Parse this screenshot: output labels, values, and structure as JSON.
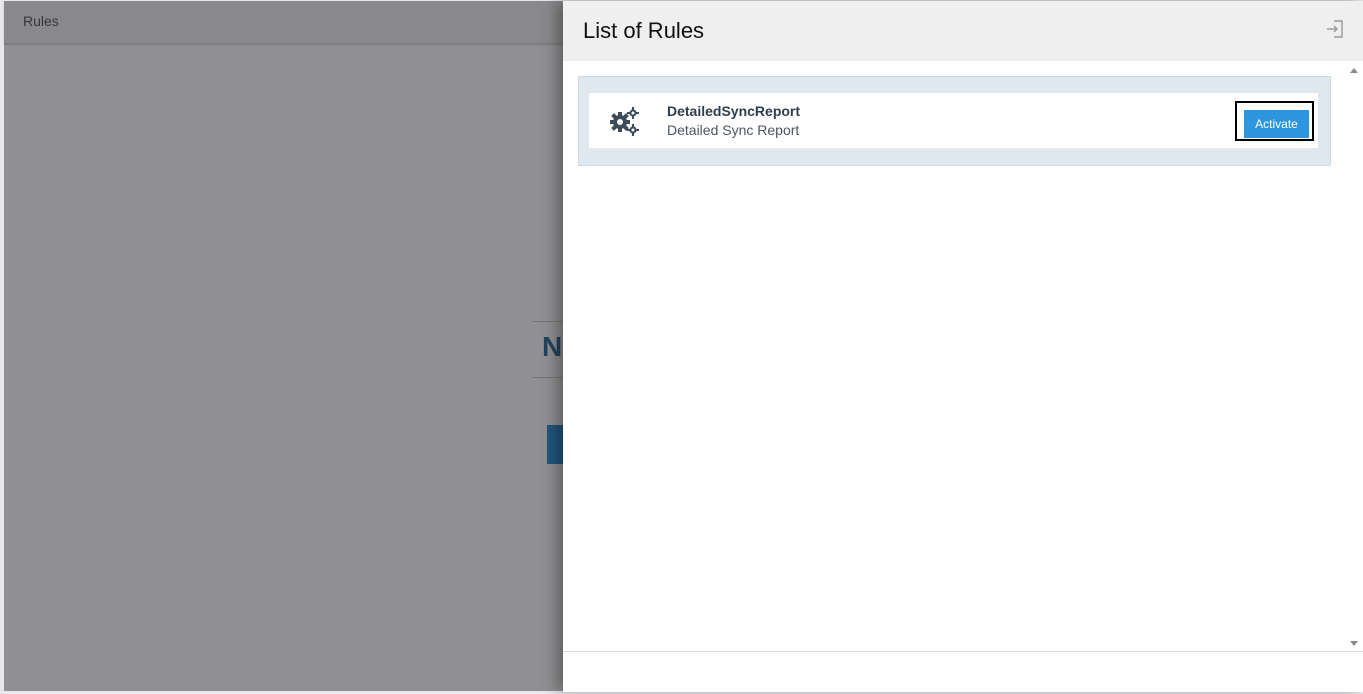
{
  "background_page": {
    "header_title": "Rules",
    "heading_fragment": "N"
  },
  "panel": {
    "title": "List of Rules",
    "close_icon": "sign-in-icon",
    "rules": [
      {
        "name": "DetailedSyncReport",
        "description": "Detailed Sync Report",
        "icon": "gears-icon",
        "action_label": "Activate"
      }
    ]
  },
  "colors": {
    "accent": "#2e96e0",
    "rule_name": "#2f3e4e",
    "list_background": "#dfe8ee",
    "bg_heading": "#2c6e9e"
  }
}
